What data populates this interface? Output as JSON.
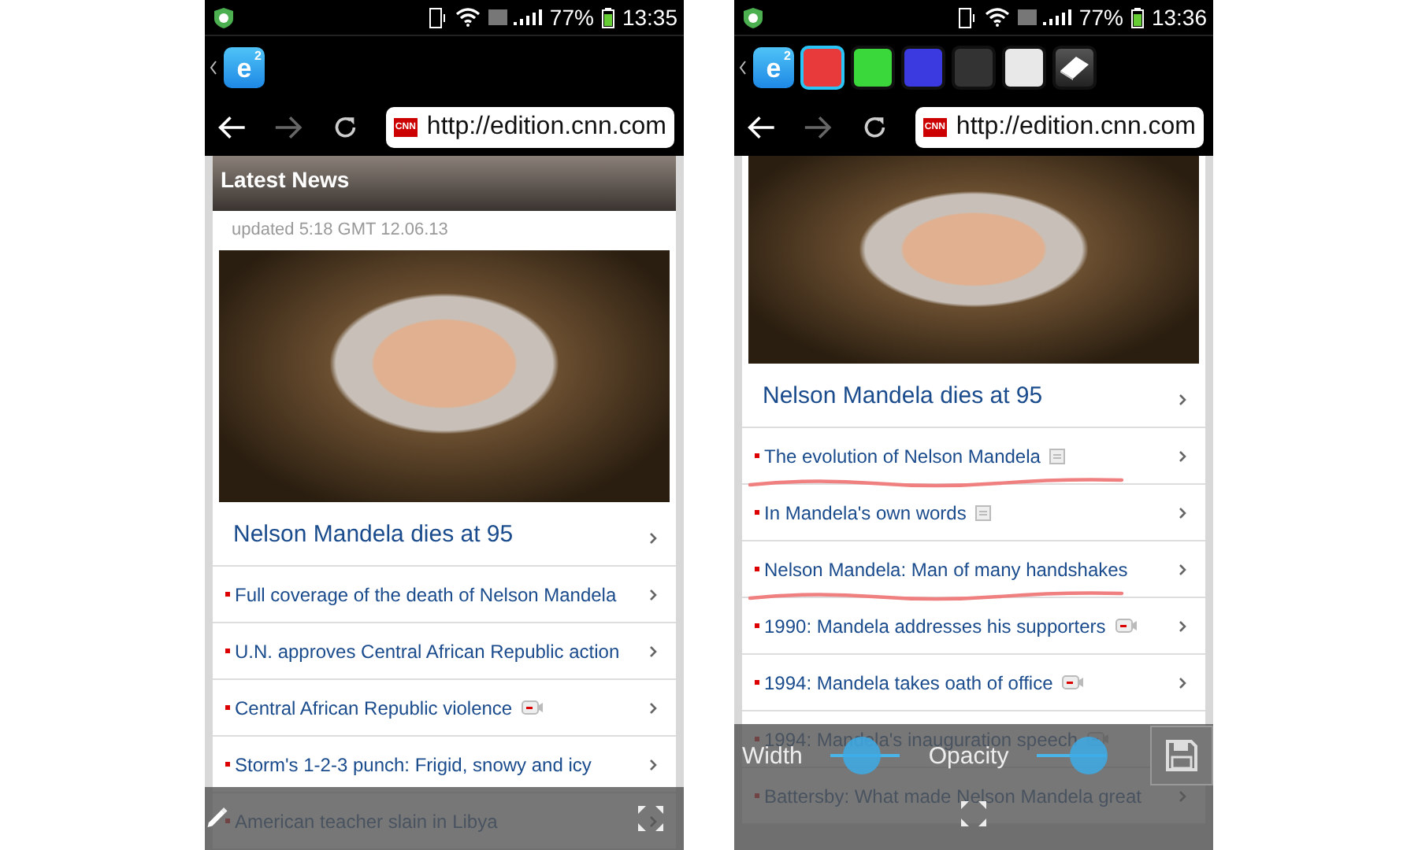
{
  "phones": [
    {
      "status": {
        "battery": "77%",
        "time": "13:35"
      },
      "logo": {
        "letter": "e",
        "sup": "2"
      },
      "address": {
        "url": "http://edition.cnn.com",
        "site_badge": "CNN"
      },
      "section_header": "Latest News",
      "updated": "updated 5:18 GMT 12.06.13",
      "headline": "Nelson Mandela dies at 95",
      "items": [
        {
          "text": "Full coverage of the death of Nelson Mandela",
          "kind": "text",
          "annotated": false
        },
        {
          "text": "U.N. approves Central African Republic action",
          "kind": "text",
          "annotated": false
        },
        {
          "text": "Central African Republic violence",
          "kind": "video",
          "annotated": false
        },
        {
          "text": "Storm's 1-2-3 punch: Frigid, snowy and icy",
          "kind": "text",
          "annotated": false
        },
        {
          "text": "American teacher slain in Libya",
          "kind": "text",
          "annotated": false
        }
      ],
      "overlay": {
        "kind": "pen"
      }
    },
    {
      "status": {
        "battery": "77%",
        "time": "13:36"
      },
      "logo": {
        "letter": "e",
        "sup": "2"
      },
      "swatches": [
        {
          "kind": "color",
          "color": "#e83a3a",
          "selected": true
        },
        {
          "kind": "color",
          "color": "#3ad83a",
          "selected": false
        },
        {
          "kind": "color",
          "color": "#3a3ae0",
          "selected": false
        },
        {
          "kind": "color",
          "color": "#333333",
          "selected": false
        },
        {
          "kind": "color",
          "color": "#e8e8e8",
          "selected": false
        },
        {
          "kind": "eraser",
          "selected": false
        }
      ],
      "address": {
        "url": "http://edition.cnn.com",
        "site_badge": "CNN"
      },
      "headline": "Nelson Mandela dies at 95",
      "items": [
        {
          "text": "The evolution of Nelson Mandela",
          "kind": "doc",
          "annotated": true
        },
        {
          "text": "In Mandela's own words",
          "kind": "doc",
          "annotated": false
        },
        {
          "text": "Nelson Mandela: Man of many handshakes",
          "kind": "text",
          "annotated": true
        },
        {
          "text": "1990: Mandela addresses his supporters",
          "kind": "video",
          "annotated": false
        },
        {
          "text": "1994: Mandela takes oath of office",
          "kind": "video",
          "annotated": false
        },
        {
          "text": "1994: Mandela's inauguration speech",
          "kind": "video",
          "annotated": false
        },
        {
          "text": "Battersby: What made Nelson Mandela great",
          "kind": "text",
          "annotated": false
        }
      ],
      "overlay": {
        "kind": "settings",
        "sliders": [
          {
            "label": "Width",
            "level": 0.45
          },
          {
            "label": "Opacity",
            "level": 0.75
          }
        ]
      }
    }
  ]
}
